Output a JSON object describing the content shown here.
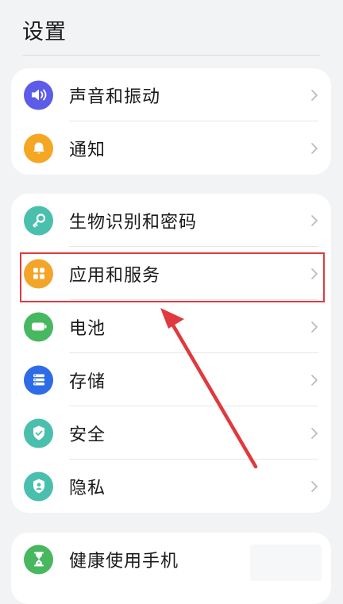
{
  "page": {
    "title": "设置"
  },
  "groups": [
    {
      "items": [
        {
          "label": "声音和振动",
          "icon": "volume-icon",
          "color": "#5c5ce8"
        },
        {
          "label": "通知",
          "icon": "bell-icon",
          "color": "#f5a623"
        }
      ]
    },
    {
      "items": [
        {
          "label": "生物识别和密码",
          "icon": "key-icon",
          "color": "#4bbfae"
        },
        {
          "label": "应用和服务",
          "icon": "apps-grid-icon",
          "color": "#f3a52a"
        },
        {
          "label": "电池",
          "icon": "battery-icon",
          "color": "#48b860"
        },
        {
          "label": "存储",
          "icon": "storage-icon",
          "color": "#2e6be6"
        },
        {
          "label": "安全",
          "icon": "shield-check-icon",
          "color": "#4bbfae"
        },
        {
          "label": "隐私",
          "icon": "privacy-shield-icon",
          "color": "#4bbfae"
        }
      ]
    },
    {
      "items": [
        {
          "label": "健康使用手机",
          "icon": "hourglass-icon",
          "color": "#48b860"
        }
      ]
    }
  ],
  "annotation": {
    "highlight_color": "#e0393e"
  }
}
